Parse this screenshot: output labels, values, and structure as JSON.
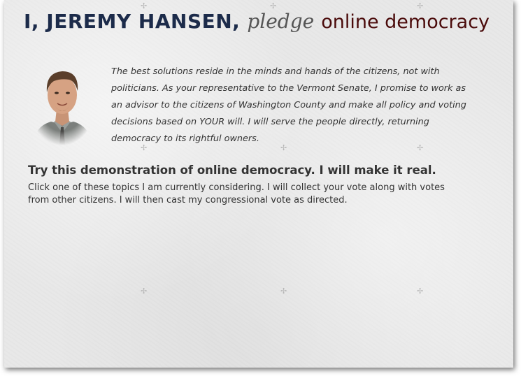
{
  "header": {
    "name": "I, JEREMY HANSEN,",
    "pledge": "pledge",
    "topic": "online democracy"
  },
  "profile": {
    "avatar": "candidate-photo"
  },
  "pledge_text": "The best solutions reside in the minds and hands of the citizens, not with politicians. As your representative to the Vermont Senate, I promise to work as an advisor to the citizens of Washington County and make all policy and voting decisions based on YOUR will. I will serve the people directly, returning democracy to its rightful owners.",
  "demo": {
    "title": "Try this demonstration of online democracy. I will make it real.",
    "instructions": "Click one of these topics I am currently considering. I will collect your vote along with votes from other citizens. I will then cast my congressional vote as directed."
  },
  "colors": {
    "name": "#1c2b4a",
    "topic": "#4a0a0a",
    "paper": "#e8e8e8"
  }
}
